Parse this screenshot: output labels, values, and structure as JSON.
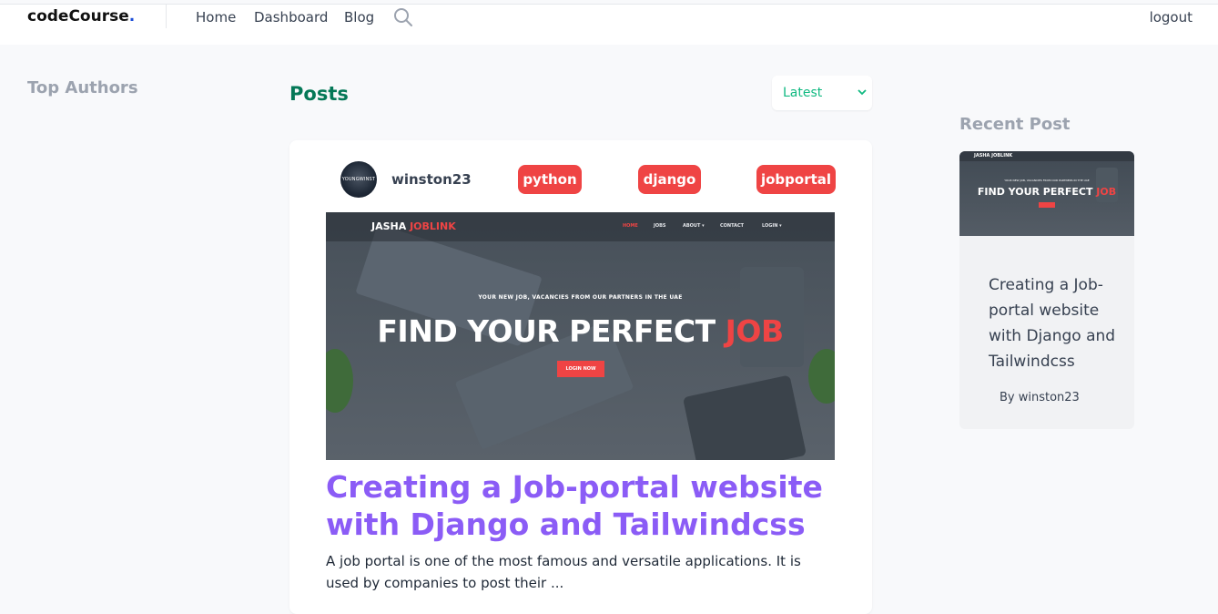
{
  "navbar": {
    "brand": "codeCourse",
    "brand_dot": ".",
    "links": [
      "Home",
      "Dashboard",
      "Blog"
    ],
    "search_icon": "search-icon",
    "logout": "logout"
  },
  "left_sidebar": {
    "title": "Top Authors"
  },
  "main": {
    "title": "Posts",
    "sort": {
      "selected": "Latest",
      "icon": "chevron-down-icon"
    },
    "post": {
      "author": "winston23",
      "avatar_text": "YOUNGWINST",
      "tags": [
        "python",
        "django",
        "jobportal"
      ],
      "image": {
        "logo_a": "JASHA ",
        "logo_b": "JOBLINK",
        "menu": [
          "HOME",
          "JOBS",
          "ABOUT ▾",
          "CONTACT",
          "LOGIN ▾"
        ],
        "subtitle": "YOUR NEW JOB, VACANCIES FROM OUR PARTNERS IN THE UAE",
        "headline_a": "FIND YOUR PERFECT ",
        "headline_b": "JOB",
        "button": "LOGIN NOW"
      },
      "title": "Creating a Job-portal website with Django and Tailwindcss",
      "excerpt": "A job portal is one of the most famous and versatile applications. It is used by companies to post their ..."
    }
  },
  "right_sidebar": {
    "title": "Recent Post",
    "post": {
      "thumb_logo": "JASHA JOBLINK",
      "thumb_subtitle": "YOUR NEW JOB, VACANCIES FROM OUR PARTNERS IN THE UAE",
      "thumb_headline_a": "FIND YOUR PERFECT ",
      "thumb_headline_b": "JOB",
      "title": "Creating a Job-portal website with Django and Tailwindcss",
      "byline": "By winston23"
    }
  },
  "colors": {
    "brand_dot": "#1d4ed8",
    "posts_title": "#047857",
    "tag_bg": "#ef4444",
    "post_title": "#8b5cf6",
    "sidebar_title": "#9ca3af"
  }
}
